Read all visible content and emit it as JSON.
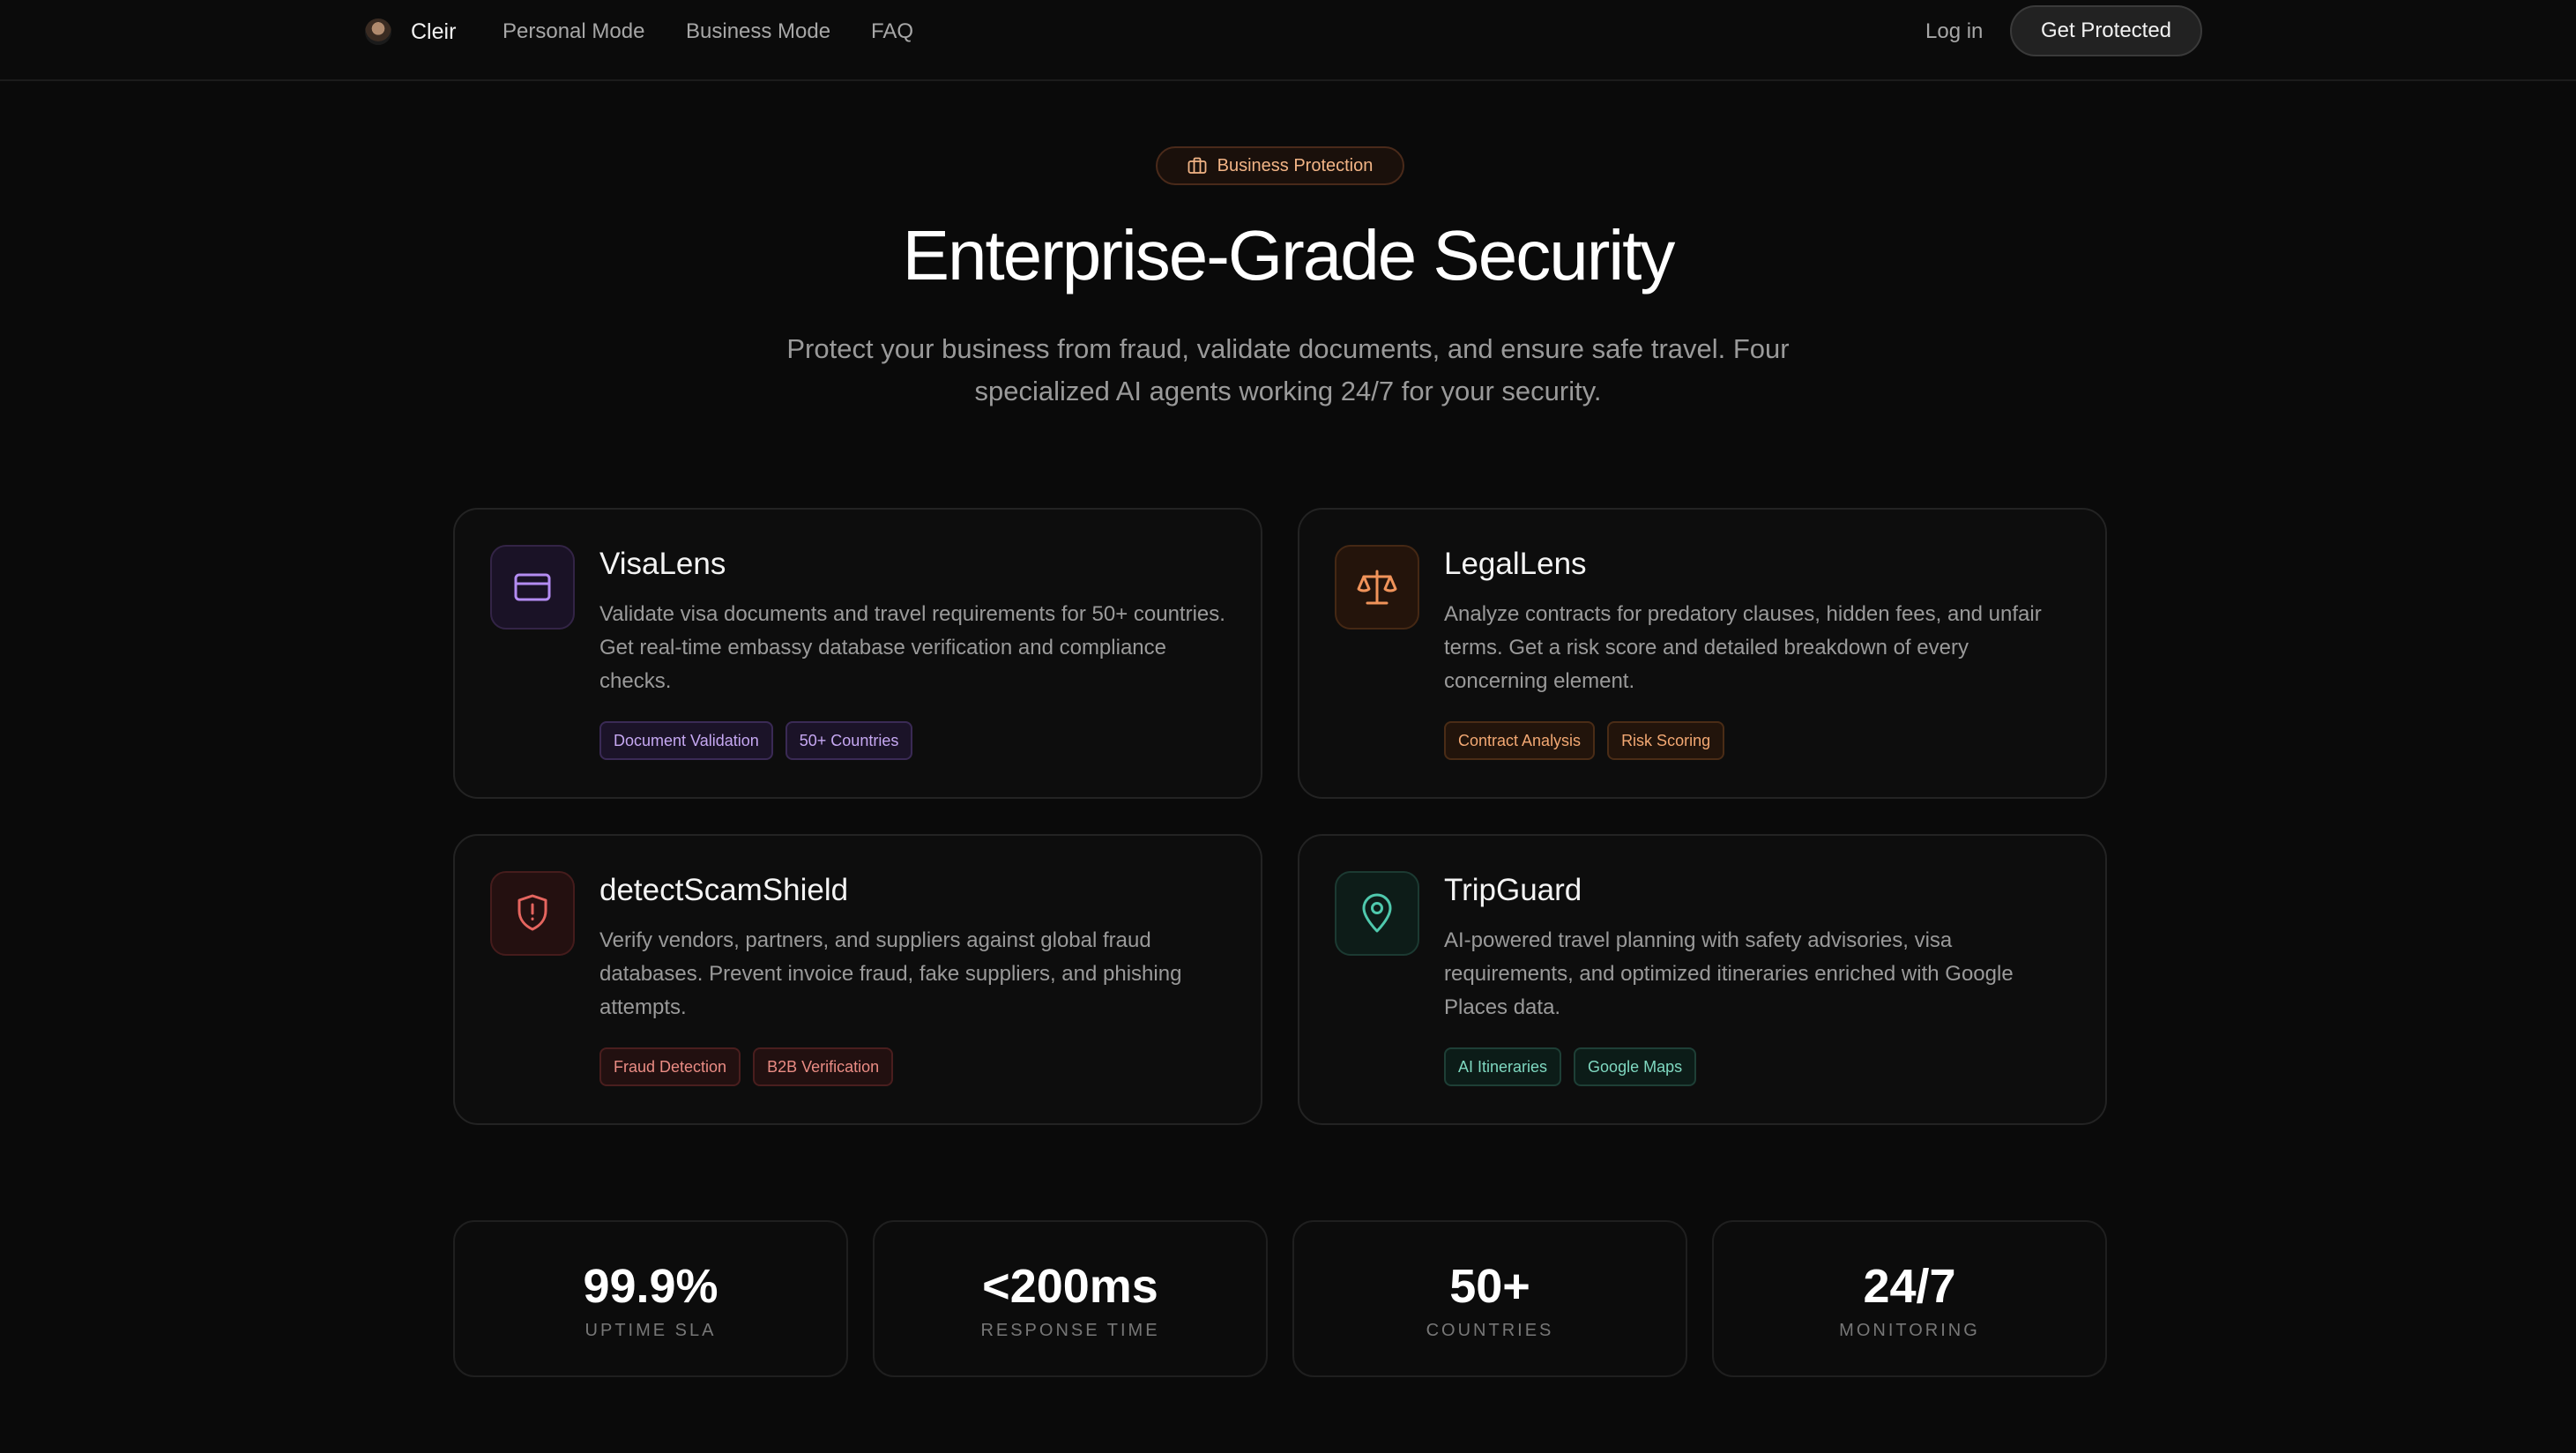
{
  "nav": {
    "brand": "Cleir",
    "links": [
      "Personal Mode",
      "Business Mode",
      "FAQ"
    ],
    "login": "Log in",
    "cta": "Get Protected"
  },
  "hero": {
    "badge": "Business Protection",
    "badge_icon": "briefcase-icon",
    "title": "Enterprise-Grade Security",
    "subtitle": "Protect your business from fraud, validate documents, and ensure safe travel. Four specialized AI agents working 24/7 for your security."
  },
  "cards": [
    {
      "title": "VisaLens",
      "icon": "credit-card-icon",
      "accent": "#b48cf2",
      "description": "Validate visa documents and travel requirements for 50+ countries. Get real-time embassy database verification and compliance checks.",
      "tags": [
        "Document Validation",
        "50+ Countries"
      ]
    },
    {
      "title": "LegalLens",
      "icon": "scales-icon",
      "accent": "#f0935a",
      "description": "Analyze contracts for predatory clauses, hidden fees, and unfair terms. Get a risk score and detailed breakdown of every concerning element.",
      "tags": [
        "Contract Analysis",
        "Risk Scoring"
      ]
    },
    {
      "title": "detectScamShield",
      "icon": "shield-alert-icon",
      "accent": "#e5655f",
      "description": "Verify vendors, partners, and suppliers against global fraud databases. Prevent invoice fraud, fake suppliers, and phishing attempts.",
      "tags": [
        "Fraud Detection",
        "B2B Verification"
      ]
    },
    {
      "title": "TripGuard",
      "icon": "map-pin-icon",
      "accent": "#4fc9ad",
      "description": "AI-powered travel planning with safety advisories, visa requirements, and optimized itineraries enriched with Google Places data.",
      "tags": [
        "AI Itineraries",
        "Google Maps"
      ]
    }
  ],
  "stats": [
    {
      "value": "99.9%",
      "label": "UPTIME SLA"
    },
    {
      "value": "<200ms",
      "label": "RESPONSE TIME"
    },
    {
      "value": "50+",
      "label": "COUNTRIES"
    },
    {
      "value": "24/7",
      "label": "MONITORING"
    }
  ]
}
